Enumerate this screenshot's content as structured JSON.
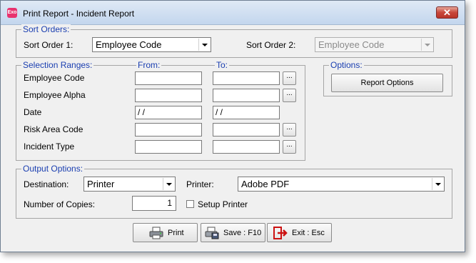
{
  "window": {
    "title": "Print Report - Incident Report",
    "app_icon_text": "Exo",
    "close_label": "✕"
  },
  "sort_orders": {
    "group_label": "Sort Orders:",
    "order1_label": "Sort Order 1:",
    "order1_value": "Employee Code",
    "order2_label": "Sort Order 2:",
    "order2_value": "Employee Code"
  },
  "selection_ranges": {
    "group_label": "Selection Ranges:",
    "from_label": "From:",
    "to_label": "To:",
    "rows": [
      {
        "label": "Employee Code",
        "from": "",
        "to": ""
      },
      {
        "label": "Employee Alpha",
        "from": "",
        "to": ""
      },
      {
        "label": "Date",
        "from": "/ /",
        "to": "/ /"
      },
      {
        "label": "Risk Area Code",
        "from": "",
        "to": ""
      },
      {
        "label": "Incident Type",
        "from": "",
        "to": ""
      }
    ],
    "ellipsis": "..."
  },
  "options": {
    "group_label": "Options:",
    "report_options_button": "Report Options"
  },
  "output_options": {
    "group_label": "Output Options:",
    "destination_label": "Destination:",
    "destination_value": "Printer",
    "printer_label": "Printer:",
    "printer_value": "Adobe PDF",
    "copies_label": "Number of Copies:",
    "copies_value": "1",
    "setup_printer_label": "Setup Printer",
    "setup_printer_checked": false
  },
  "buttons": {
    "print": "Print",
    "save": "Save : F10",
    "exit": "Exit : Esc"
  }
}
